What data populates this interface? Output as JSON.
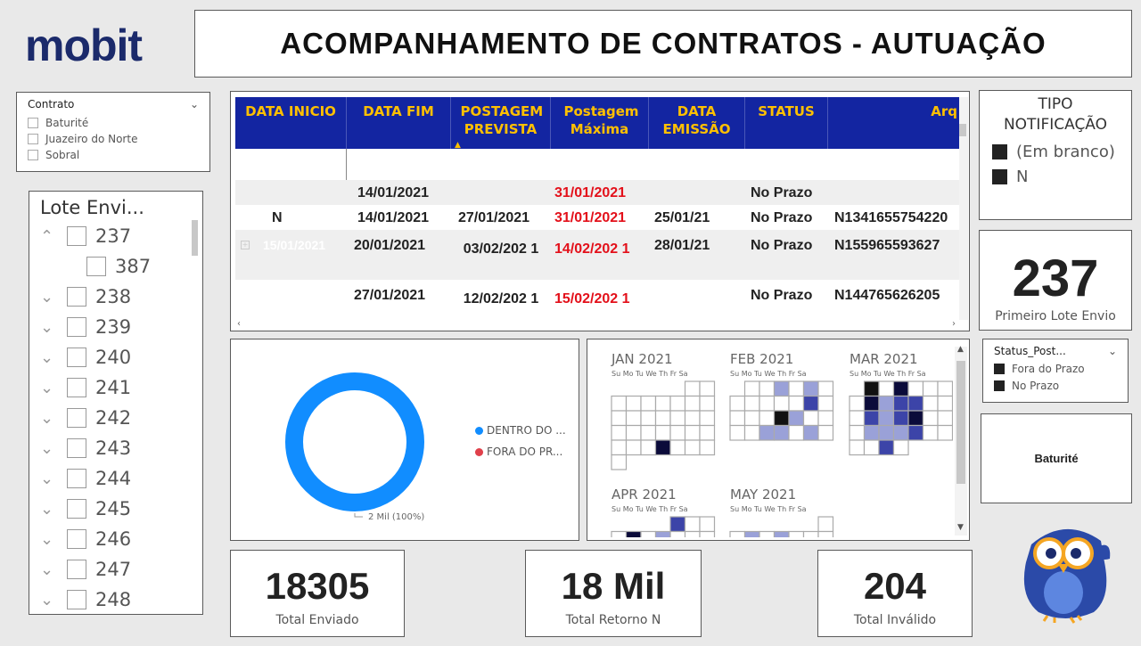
{
  "logo": "mobit",
  "title": "ACOMPANHAMENTO DE CONTRATOS - AUTUAÇÃO",
  "contrato_slicer": {
    "title": "Contrato",
    "items": [
      "Baturité",
      "Juazeiro do Norte",
      "Sobral"
    ]
  },
  "lote_slicer": {
    "title": "Lote Envi...",
    "items": [
      "237",
      "387",
      "238",
      "239",
      "240",
      "241",
      "242",
      "243",
      "244",
      "245",
      "246",
      "247",
      "248"
    ]
  },
  "table": {
    "headers": [
      "DATA INICIO",
      "DATA FIM",
      "POSTAGEM PREVISTA",
      "Postagem Máxima",
      "DATA EMISSÃO",
      "STATUS",
      "Arq"
    ],
    "rows": [
      {
        "inicio": "",
        "fim": "14/01/2021",
        "prevista": "",
        "maxima": "31/01/2021",
        "emissao": "",
        "status": "No Prazo",
        "arq": ""
      },
      {
        "inicio": "N",
        "fim": "14/01/2021",
        "prevista": "27/01/2021",
        "maxima": "31/01/2021",
        "emissao": "25/01/21",
        "status": "No Prazo",
        "arq": "N1341655754220"
      },
      {
        "inicio": "15/01/2021",
        "fim": "20/01/2021",
        "prevista": "03/02/202 1",
        "maxima": "14/02/202 1",
        "emissao": "28/01/21",
        "status": "No Prazo",
        "arq": "N155965593627"
      },
      {
        "inicio": "",
        "fim": "27/01/2021",
        "prevista": "12/02/202 1",
        "maxima": "15/02/202 1",
        "emissao": "",
        "status": "No Prazo",
        "arq": "N144765626205"
      }
    ]
  },
  "tipo_notificacao": {
    "title": "TIPO NOTIFICAÇÃO",
    "items": [
      "(Em branco)",
      "N"
    ]
  },
  "primeiro_lote": {
    "value": "237",
    "label": "Primeiro Lote Envio"
  },
  "status_post": {
    "title": "Status_Post...",
    "items": [
      "Fora do Prazo",
      "No Prazo"
    ]
  },
  "contrato_card": "Baturité",
  "donut": {
    "label": "2 Mil (100%)",
    "legend": [
      "DENTRO DO ...",
      "FORA DO PR..."
    ],
    "colors": [
      "#118dff",
      "#e0404a"
    ]
  },
  "calendar": {
    "day_header": "Su Mo Tu We Th Fr Sa",
    "months": [
      "JAN 2021",
      "FEB 2021",
      "MAR 2021",
      "APR 2021",
      "MAY 2021"
    ]
  },
  "kpis": [
    {
      "value": "18305",
      "label": "Total Enviado"
    },
    {
      "value": "18 Mil",
      "label": "Total Retorno N"
    },
    {
      "value": "204",
      "label": "Total Inválido"
    }
  ],
  "colors": {
    "header_bg": "#1325a1",
    "header_text": "#ffc000",
    "red": "#e3101a",
    "brand": "#1b2a6b"
  }
}
